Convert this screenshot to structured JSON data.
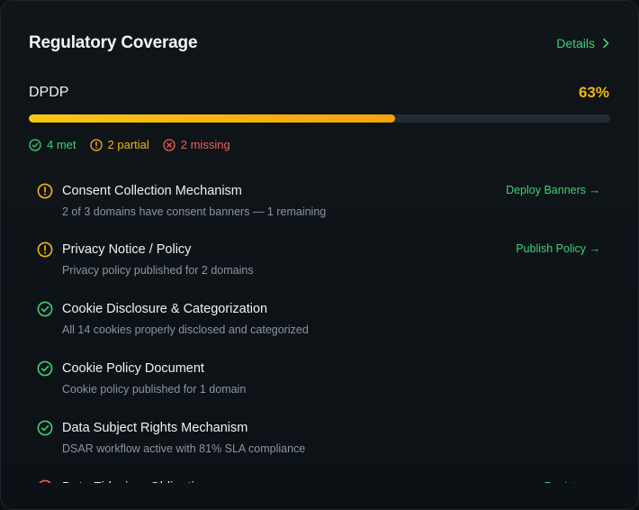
{
  "card": {
    "title": "Regulatory Coverage",
    "details_label": "Details"
  },
  "framework": {
    "name": "DPDP",
    "percent_label": "63%",
    "progress": 0.63
  },
  "summary": {
    "met": "4 met",
    "partial": "2 partial",
    "missing": "2 missing"
  },
  "colors": {
    "met": "#3dd07a",
    "partial": "#f5b40f",
    "missing": "#f25c5c",
    "progress_start": "#f7c614",
    "progress_end": "#f5a30c"
  },
  "requirements": [
    {
      "status": "partial",
      "icon": "alert-circle-icon",
      "title": "Consent Collection Mechanism",
      "description": "2 of 3 domains have consent banners — 1 remaining",
      "action": "Deploy Banners →"
    },
    {
      "status": "partial",
      "icon": "alert-circle-icon",
      "title": "Privacy Notice / Policy",
      "description": "Privacy policy published for 2 domains",
      "action": "Publish Policy →"
    },
    {
      "status": "met",
      "icon": "check-circle-icon",
      "title": "Cookie Disclosure & Categorization",
      "description": "All 14 cookies properly disclosed and categorized",
      "action": ""
    },
    {
      "status": "met",
      "icon": "check-circle-icon",
      "title": "Cookie Policy Document",
      "description": "Cookie policy published for 1 domain",
      "action": ""
    },
    {
      "status": "met",
      "icon": "check-circle-icon",
      "title": "Data Subject Rights Mechanism",
      "description": "DSAR workflow active with 81% SLA compliance",
      "action": ""
    },
    {
      "status": "missing",
      "icon": "x-circle-icon",
      "title": "Data Fiduciary Obligations",
      "description": "",
      "action": "Register →"
    }
  ]
}
